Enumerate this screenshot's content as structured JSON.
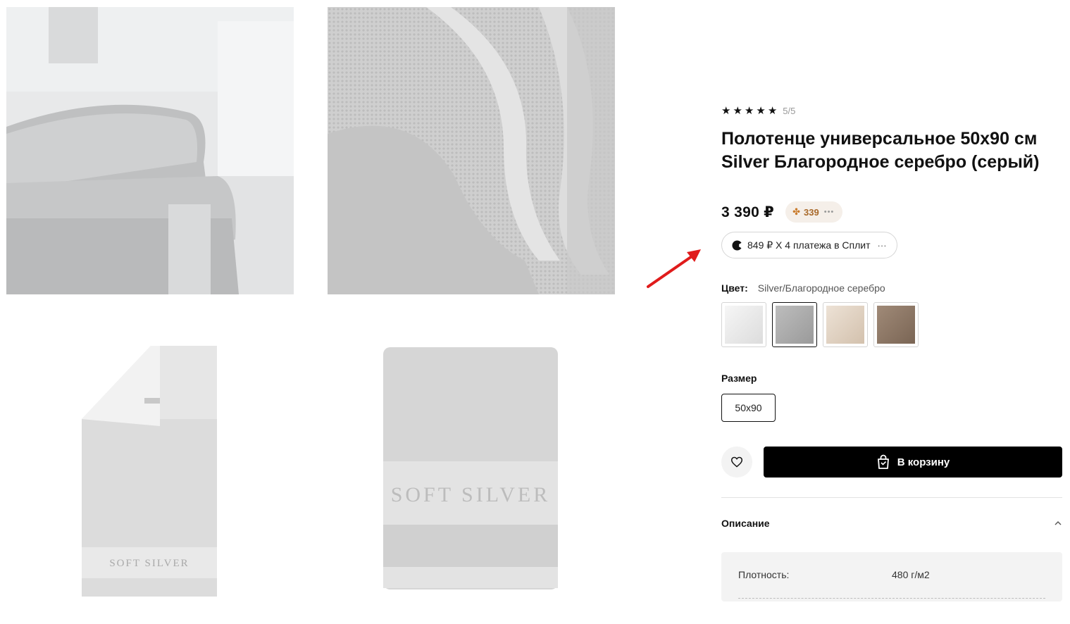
{
  "product": {
    "rating_stars": 5,
    "rating_text": "5/5",
    "title": "Полотенце универсальное 50х90 см Silver Благородное серебро (серый)",
    "price": "3 390 ₽",
    "bonus": {
      "value": "339",
      "dots": "•••"
    },
    "split": {
      "text": "849 ₽ X 4 платежа в Сплит",
      "more": "···"
    }
  },
  "color": {
    "label": "Цвет:",
    "value": "Silver/Благородное серебро",
    "swatches": [
      {
        "name": "white",
        "color": "#ececec"
      },
      {
        "name": "silver",
        "color": "#a9a9a9",
        "selected": true
      },
      {
        "name": "cream",
        "color": "#e1d3c3"
      },
      {
        "name": "brown",
        "color": "#8b7665"
      }
    ]
  },
  "size": {
    "label": "Размер",
    "value": "50х90"
  },
  "actions": {
    "cart_label": "В корзину"
  },
  "description": {
    "title": "Описание",
    "specs": [
      {
        "key": "Плотность:",
        "value": "480 г/м2"
      }
    ]
  },
  "gallery": {
    "logo_text": "SOFT SILVER"
  }
}
